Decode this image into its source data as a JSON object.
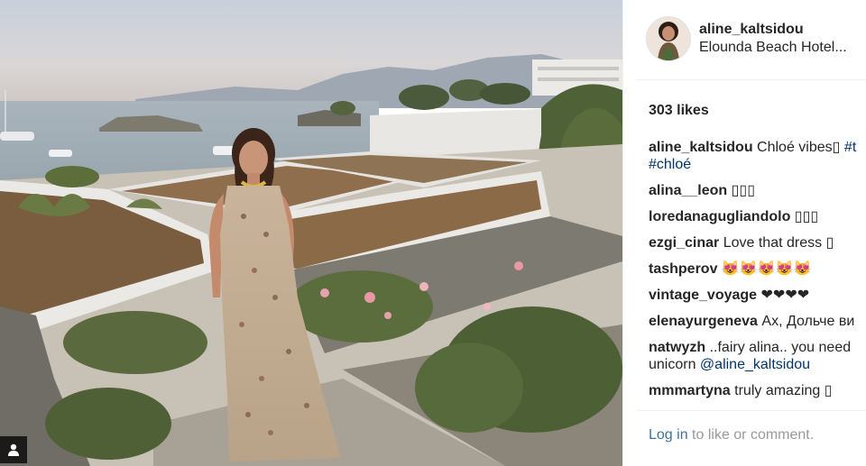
{
  "post": {
    "username": "aline_kaltsidou",
    "location": "Elounda Beach Hotel...",
    "likes": "303 likes"
  },
  "comments": [
    {
      "user": "aline_kaltsidou",
      "text": "Chloé vibes",
      "extra": " #t",
      "line2": "#chloé"
    },
    {
      "user": "alina__leon",
      "text": ""
    },
    {
      "user": "loredanagugliandolo",
      "text": ""
    },
    {
      "user": "ezgi_cinar",
      "text": "Love that dress "
    },
    {
      "user": "tashperov",
      "text": "😻😻😻😻😻"
    },
    {
      "user": "vintage_voyage",
      "text": "❤❤❤❤"
    },
    {
      "user": "elenayurgeneva",
      "text": "Ах, Дольче ви"
    },
    {
      "user": "natwyzh",
      "text": "..fairy alina..  you need",
      "line2_text": "unicorn ",
      "line2_tag": "@aline_kaltsidou"
    },
    {
      "user": "mmmartyna",
      "text": "truly amazing "
    }
  ],
  "footer": {
    "login_link": "Log in",
    "login_text": " to like or comment."
  },
  "icons": {
    "tag": "person-tag-icon"
  }
}
